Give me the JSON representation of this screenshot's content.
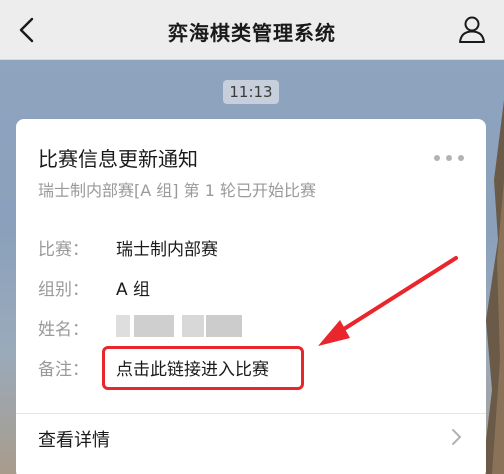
{
  "nav": {
    "title": "弈海棋类管理系统",
    "back_icon": "chevron-left-icon",
    "profile_icon": "user-icon"
  },
  "chat": {
    "time": "11:13"
  },
  "card": {
    "title": "比赛信息更新通知",
    "subtitle": "瑞士制内部赛[A 组] 第 1 轮已开始比赛",
    "more_icon": "more-dots-icon",
    "fields": [
      {
        "label": "比赛：",
        "value": "瑞士制内部赛"
      },
      {
        "label": "组别：",
        "value": "A 组"
      },
      {
        "label": "姓名：",
        "value": ""
      },
      {
        "label": "备注：",
        "value": "点击此链接进入比赛"
      }
    ],
    "detail_label": "查看详情",
    "detail_icon": "chevron-right-icon"
  },
  "annotation": {
    "color": "#e8262b"
  }
}
